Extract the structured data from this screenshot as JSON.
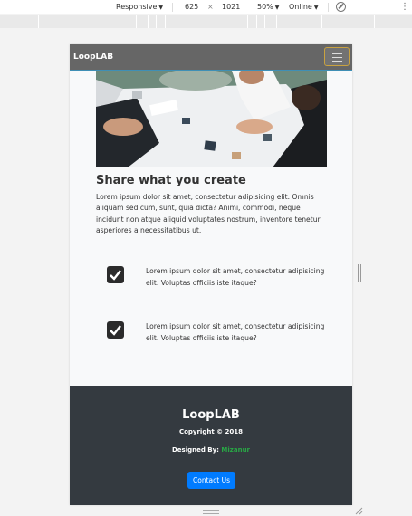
{
  "devtools": {
    "device": "Responsive",
    "width": "625",
    "times": "×",
    "height": "1021",
    "zoom": "50%",
    "network": "Online",
    "rotate_icon": "rotate-icon"
  },
  "nav": {
    "brand": "LoopLAB",
    "toggler_icon": "hamburger-icon"
  },
  "hero": {
    "alt": "team-meeting-photo"
  },
  "section": {
    "heading": "Share what you create",
    "paragraph": "Lorem ipsum dolor sit amet, consectetur adipisicing elit. Omnis aliquam sed cum, sunt, quia dicta? Animi, commodi, neque incidunt non atque aliquid voluptates nostrum, inventore tenetur asperiores a necessitatibus ut."
  },
  "features": [
    {
      "text": "Lorem ipsum dolor sit amet, consectetur adipisicing elit. Voluptas officiis iste itaque?",
      "icon": "checkbox-icon"
    },
    {
      "text": "Lorem ipsum dolor sit amet, consectetur adipisicing elit. Voluptas officiis iste itaque?",
      "icon": "checkbox-icon"
    }
  ],
  "footer": {
    "brand": "LoopLAB",
    "copyright": "Copyright © 2018",
    "designed_by_label": "Designed By: ",
    "designer": "Mizanur",
    "button": "Contact Us"
  },
  "colors": {
    "footer_bg": "#343a40",
    "button": "#007bff",
    "designer_link": "#28a745",
    "toggler_border": "#c9a240"
  }
}
